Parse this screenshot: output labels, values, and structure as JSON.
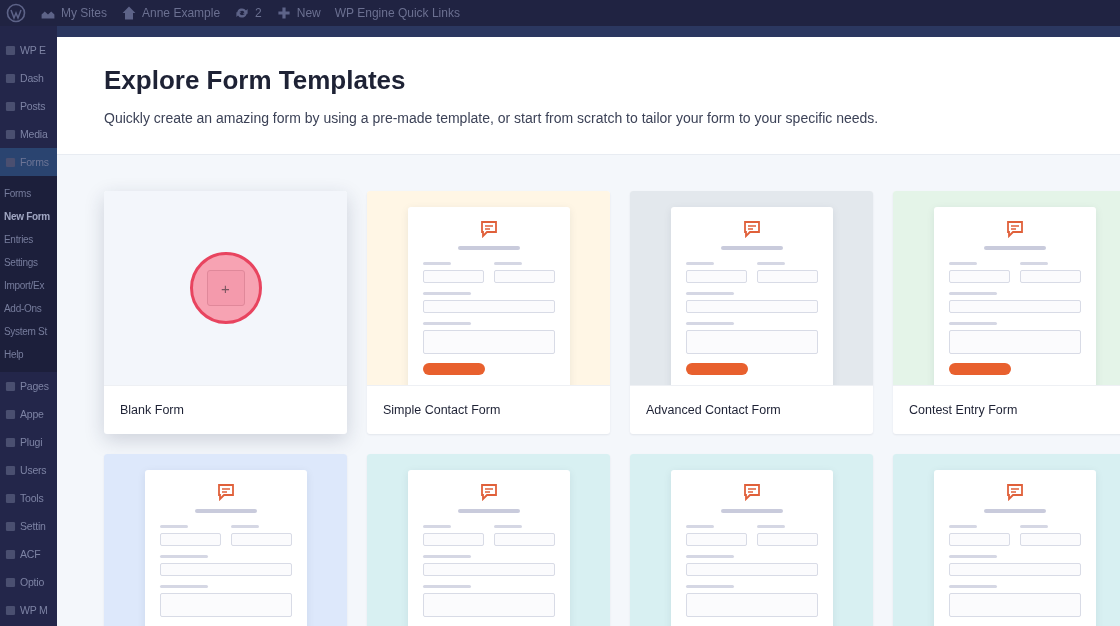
{
  "admin_bar": {
    "items": [
      {
        "label": "My Sites"
      },
      {
        "label": "Anne Example"
      },
      {
        "label": "2"
      },
      {
        "label": "New"
      },
      {
        "label": "WP Engine Quick Links"
      }
    ]
  },
  "sidebar": {
    "items": [
      {
        "label": "WP E",
        "selected": false
      },
      {
        "label": "Dash",
        "selected": false
      },
      {
        "label": "Posts",
        "selected": false
      },
      {
        "label": "Media",
        "selected": false
      },
      {
        "label": "Forms",
        "selected": true,
        "children": [
          {
            "label": "Forms",
            "selected": false
          },
          {
            "label": "New Form",
            "selected": true
          },
          {
            "label": "Entries",
            "selected": false
          },
          {
            "label": "Settings",
            "selected": false
          },
          {
            "label": "Import/Ex",
            "selected": false
          },
          {
            "label": "Add-Ons",
            "selected": false
          },
          {
            "label": "System St",
            "selected": false
          },
          {
            "label": "Help",
            "selected": false
          }
        ]
      },
      {
        "label": "Pages",
        "selected": false
      },
      {
        "label": "Appe",
        "selected": false
      },
      {
        "label": "Plugi",
        "selected": false
      },
      {
        "label": "Users",
        "selected": false
      },
      {
        "label": "Tools",
        "selected": false
      },
      {
        "label": "Settin",
        "selected": false
      },
      {
        "label": "ACF",
        "selected": false
      },
      {
        "label": "Optio",
        "selected": false
      },
      {
        "label": "WP M",
        "selected": false
      }
    ]
  },
  "modal": {
    "title": "Explore Form Templates",
    "description": "Quickly create an amazing form by using a pre-made template, or start from scratch to tailor your form to your specific needs.",
    "templates": [
      {
        "kind": "blank",
        "title": "Blank Form",
        "add_label": "+",
        "selected": true
      },
      {
        "kind": "template",
        "title": "Simple Contact Form",
        "color": "#fff6e5",
        "selected": false
      },
      {
        "kind": "template",
        "title": "Advanced Contact Form",
        "color": "#e3e8ed",
        "selected": false
      },
      {
        "kind": "template",
        "title": "Contest Entry Form",
        "color": "#e4f4e8",
        "selected": false
      },
      {
        "kind": "template",
        "color": "#dde8fb",
        "selected": false
      },
      {
        "kind": "template",
        "color": "#d8f0f2",
        "selected": false
      },
      {
        "kind": "template",
        "color": "#d8f0f2",
        "selected": false
      },
      {
        "kind": "template",
        "color": "#d8f0f2",
        "selected": false
      }
    ]
  }
}
